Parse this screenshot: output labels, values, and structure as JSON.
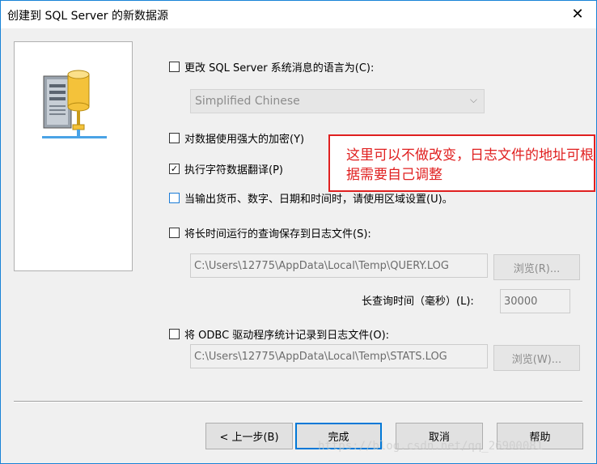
{
  "window": {
    "title": "创建到 SQL Server 的新数据源",
    "close_glyph": "✕"
  },
  "options": {
    "change_language": {
      "label": "更改 SQL Server 系统消息的语言为(C):",
      "checked": false
    },
    "language_select": {
      "value": "Simplified Chinese"
    },
    "strong_encryption": {
      "label": "对数据使用强大的加密(Y)",
      "checked": false
    },
    "char_translation": {
      "label": "执行字符数据翻译(P)",
      "checked": true,
      "check_glyph": "✓"
    },
    "regional_settings": {
      "label": "当输出货币、数字、日期和时间时，请使用区域设置(U)。",
      "checked": false
    },
    "save_long_queries": {
      "label": "将长时间运行的查询保存到日志文件(S):",
      "checked": false,
      "path": "C:\\Users\\12775\\AppData\\Local\\Temp\\QUERY.LOG",
      "browse_label": "浏览(R)..."
    },
    "long_query_time": {
      "label": "长查询时间（毫秒）(L):",
      "value": "30000"
    },
    "log_odbc_stats": {
      "label": "将 ODBC 驱动程序统计记录到日志文件(O):",
      "checked": false,
      "path": "C:\\Users\\12775\\AppData\\Local\\Temp\\STATS.LOG",
      "browse_label": "浏览(W)..."
    }
  },
  "buttons": {
    "back": "< 上一步(B)",
    "finish": "完成",
    "cancel": "取消",
    "help": "帮助"
  },
  "annotation": {
    "text": "这里可以不做改变，日志文件的地址可根据需要自己调整"
  },
  "watermark": {
    "text": "https://blog.csdn.net/qq_26900081"
  },
  "colors": {
    "accent": "#0078d7",
    "annotation": "#e02020",
    "disabled_text": "#8c8c8c"
  }
}
